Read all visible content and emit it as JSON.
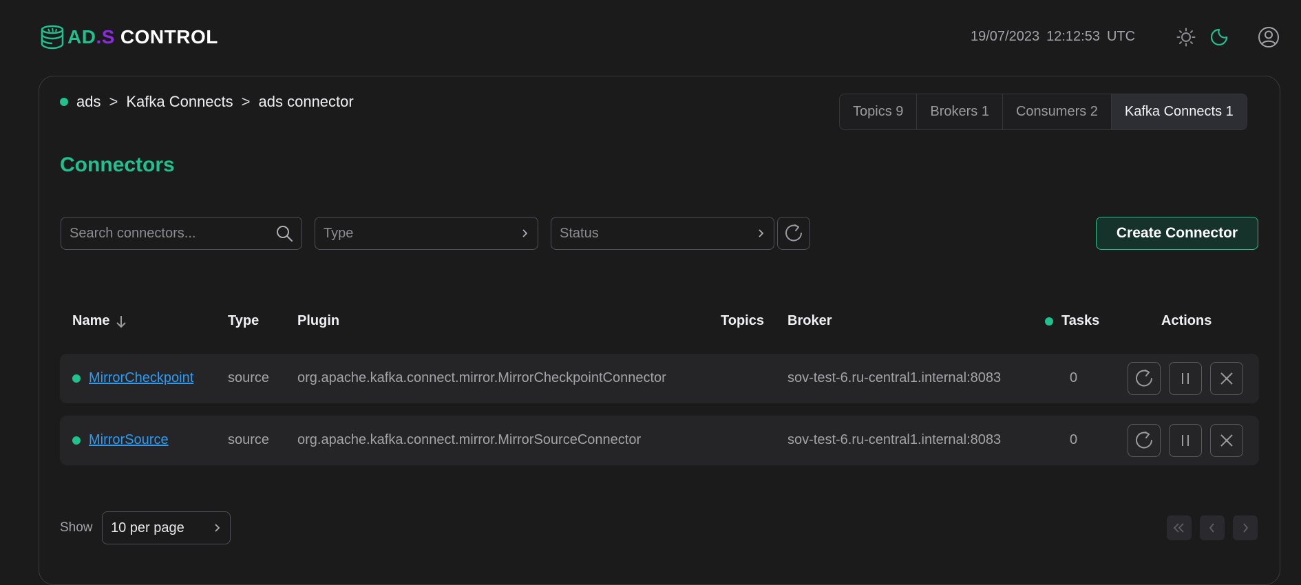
{
  "app": {
    "logo_ads": "AD",
    "logo_dot": ".S",
    "logo_control": "CONTROL"
  },
  "header": {
    "date": "19/07/2023",
    "time": "12:12:53",
    "timezone": "UTC",
    "icons": [
      "sun-icon",
      "moon-icon",
      "user-icon"
    ]
  },
  "breadcrumb": [
    "ads",
    "Kafka Connects",
    "ads connector"
  ],
  "breadcrumb_sep": ">",
  "tabs": [
    {
      "label": "Topics 9",
      "active": false
    },
    {
      "label": "Brokers 1",
      "active": false
    },
    {
      "label": "Consumers 2",
      "active": false
    },
    {
      "label": "Kafka Connects 1",
      "active": true
    }
  ],
  "page_title": "Connectors",
  "filters": {
    "search_placeholder": "Search connectors...",
    "type_placeholder": "Type",
    "status_placeholder": "Status",
    "create_label": "Create Connector"
  },
  "table": {
    "columns": [
      "Name",
      "Type",
      "Plugin",
      "Topics",
      "Broker",
      "Tasks",
      "Actions"
    ],
    "rows": [
      {
        "name": "MirrorCheckpoint",
        "type": "source",
        "plugin": "org.apache.kafka.connect.mirror.MirrorCheckpointConnector",
        "topics": "",
        "broker": "sov-test-6.ru-central1.internal:8083",
        "tasks": "0"
      },
      {
        "name": "MirrorSource",
        "type": "source",
        "plugin": "org.apache.kafka.connect.mirror.MirrorSourceConnector",
        "topics": "",
        "broker": "sov-test-6.ru-central1.internal:8083",
        "tasks": "0"
      }
    ]
  },
  "footer": {
    "show_label": "Show",
    "per_page": "10 per page"
  },
  "colors": {
    "accent": "#1fc28f",
    "link": "#2c9cf2",
    "background": "#1b1b1c",
    "row_bg": "#252528"
  }
}
